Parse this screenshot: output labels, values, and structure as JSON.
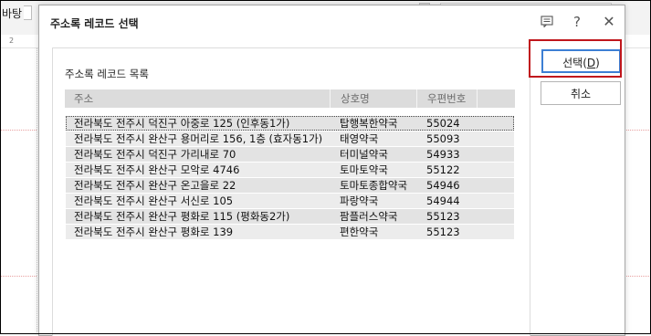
{
  "background_app": {
    "label_fragment": "바탕",
    "ruler_number": "2"
  },
  "dialog": {
    "title": "주소록 레코드 선택",
    "icons": {
      "feedback": "feedback-icon",
      "help": "?",
      "close": "✕"
    },
    "list_caption": "주소록 레코드 목록",
    "columns": [
      "주소",
      "상호명",
      "우편번호"
    ],
    "rows": [
      {
        "address": "전라북도 전주시 덕진구 아중로 125 (인후동1가)",
        "name": "탑행복한약국",
        "zip": "55024"
      },
      {
        "address": "전라북도 전주시 완산구 용머리로 156, 1층 (효자동1가)",
        "name": "태영약국",
        "zip": "55093"
      },
      {
        "address": "전라북도 전주시 덕진구 가리내로 70",
        "name": "터미널약국",
        "zip": "54933"
      },
      {
        "address": "전라북도 전주시 완산구 모악로 4746",
        "name": "토마토약국",
        "zip": "55122"
      },
      {
        "address": "전라북도 전주시 완산구 온고을로 22",
        "name": "토마토종합약국",
        "zip": "54946"
      },
      {
        "address": "전라북도 전주시 완산구 서신로 105",
        "name": "파랑약국",
        "zip": "54944"
      },
      {
        "address": "전라북도 전주시 완산구 평화로 115 (평화동2가)",
        "name": "팜플러스약국",
        "zip": "55123"
      },
      {
        "address": "전라북도 전주시 완산구 평화로 139",
        "name": "편한약국",
        "zip": "55123"
      }
    ],
    "buttons": {
      "select_label": "선택",
      "select_hotkey_open": "(",
      "select_hotkey": "D",
      "select_hotkey_close": ")",
      "cancel_label": "취소"
    }
  },
  "colors": {
    "highlight_frame": "#c0161c",
    "focus_border": "#3c7fd4"
  }
}
